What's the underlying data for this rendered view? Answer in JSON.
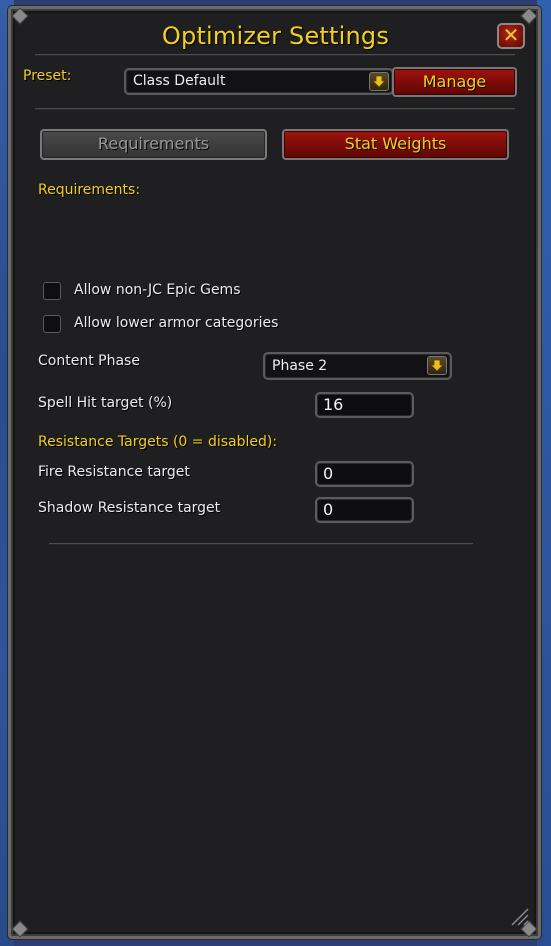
{
  "window": {
    "title": "Optimizer Settings",
    "close_label": "✕"
  },
  "preset": {
    "label": "Preset:",
    "selected": "Class Default",
    "manage_label": "Manage"
  },
  "tabs": [
    {
      "label": "Requirements",
      "active": true
    },
    {
      "label": "Stat Weights",
      "active": false
    }
  ],
  "requirements": {
    "section_label": "Requirements:",
    "checkboxes": [
      {
        "label": "Allow non-JC Epic Gems",
        "checked": false
      },
      {
        "label": "Allow lower armor categories",
        "checked": false
      }
    ],
    "content_phase": {
      "label": "Content Phase",
      "selected": "Phase 2"
    },
    "spell_hit": {
      "label": "Spell Hit target (%)",
      "value": "16"
    },
    "resistance_heading": "Resistance Targets (0 = disabled):",
    "fire": {
      "label": "Fire Resistance target",
      "value": "0"
    },
    "shadow": {
      "label": "Shadow Resistance target",
      "value": "0"
    }
  },
  "colors": {
    "gold": "#f2cf1f",
    "panel": "#1f1f22",
    "button_red": "#8a100c"
  },
  "icons": {
    "close": "close-icon",
    "dropdown": "chevron-down-icon",
    "resize": "resize-grip-icon"
  }
}
